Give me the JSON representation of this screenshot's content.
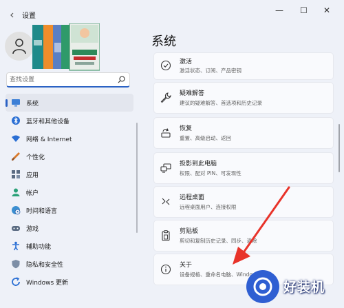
{
  "window": {
    "title": "设置",
    "controls": {
      "minimize": "—",
      "maximize": "☐",
      "close": "✕"
    }
  },
  "search": {
    "placeholder": "查找设置",
    "value": ""
  },
  "sidebar": {
    "items": [
      {
        "label": "系统",
        "icon": "monitor-icon",
        "selected": true
      },
      {
        "label": "蓝牙和其他设备",
        "icon": "bluetooth-icon"
      },
      {
        "label": "网络 & Internet",
        "icon": "wifi-icon"
      },
      {
        "label": "个性化",
        "icon": "brush-icon"
      },
      {
        "label": "应用",
        "icon": "apps-icon"
      },
      {
        "label": "帐户",
        "icon": "person-icon"
      },
      {
        "label": "时间和语言",
        "icon": "globe-clock-icon"
      },
      {
        "label": "游戏",
        "icon": "gamepad-icon"
      },
      {
        "label": "辅助功能",
        "icon": "accessibility-icon"
      },
      {
        "label": "隐私和安全性",
        "icon": "shield-icon"
      },
      {
        "label": "Windows 更新",
        "icon": "update-icon"
      }
    ]
  },
  "main": {
    "title": "系统",
    "cards": [
      {
        "title": "激活",
        "desc": "激活状态、订阅、产品密钥",
        "icon": "check-circle-icon"
      },
      {
        "title": "疑难解答",
        "desc": "建议的疑难解答、首选项和历史记录",
        "icon": "wrench-icon"
      },
      {
        "title": "恢复",
        "desc": "重置、高级启动、返回",
        "icon": "recovery-icon"
      },
      {
        "title": "投影到此电脑",
        "desc": "权限、配对 PIN、可发现性",
        "icon": "projection-icon"
      },
      {
        "title": "远程桌面",
        "desc": "远程桌面用户、连接权限",
        "icon": "remote-desktop-icon"
      },
      {
        "title": "剪贴板",
        "desc": "剪切和复制历史记录、同步、清除",
        "icon": "clipboard-icon"
      },
      {
        "title": "关于",
        "desc": "设备规格、重命名电脑、Windows 规格",
        "icon": "info-icon"
      }
    ]
  },
  "watermark": {
    "text": "好装机"
  },
  "colors": {
    "accent": "#2b62c4",
    "arrow": "#e8332a",
    "background": "#eef1f8"
  }
}
